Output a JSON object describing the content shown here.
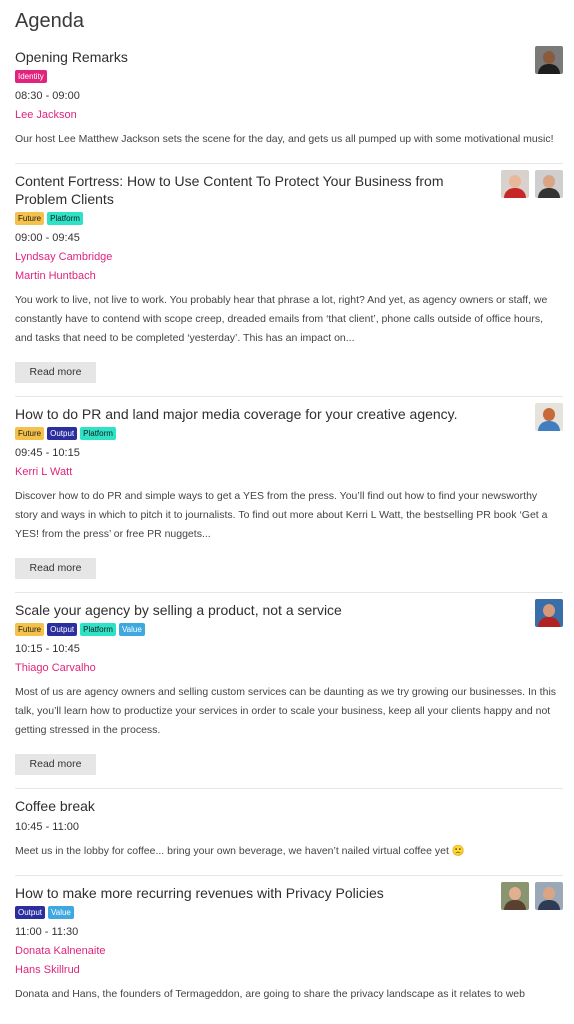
{
  "page": {
    "title": "Agenda"
  },
  "tag_colors": {
    "Identity": {
      "bg": "#e0247e",
      "fg": "#ffffff"
    },
    "Future": {
      "bg": "#f4c24a",
      "fg": "#1a1a1a"
    },
    "Platform": {
      "bg": "#2de2c6",
      "fg": "#1a1a1a"
    },
    "Output": {
      "bg": "#2b2f9e",
      "fg": "#ffffff"
    },
    "Value": {
      "bg": "#3fa8e0",
      "fg": "#ffffff"
    }
  },
  "sessions": [
    {
      "title": "Opening Remarks",
      "tags": [
        "Identity"
      ],
      "time": "08:30 - 09:00",
      "speakers": [
        "Lee Jackson"
      ],
      "description": "Our host Lee Matthew Jackson sets the scene for the day, and gets us all pumped up with some motivational music!",
      "read_more": "",
      "avatars": [
        {
          "bg": "#7a7a7a",
          "skin": "#8a5a3c",
          "shirt": "#1e1e1e"
        }
      ]
    },
    {
      "title": "Content Fortress: How to Use Content To Protect Your Business from Problem Clients",
      "tags": [
        "Future",
        "Platform"
      ],
      "time": "09:00 - 09:45",
      "speakers": [
        "Lyndsay Cambridge",
        "Martin Huntbach"
      ],
      "description": "You work to live, not live to work. You probably hear that phrase a lot, right? And yet, as agency owners or staff, we constantly have to contend with scope creep, dreaded emails from ‘that client’, phone calls outside of office hours, and tasks that need to be completed ‘yesterday’. This has an impact on...",
      "read_more": "Read more",
      "avatars": [
        {
          "bg": "#d9d2cc",
          "skin": "#e8b89a",
          "shirt": "#c62828"
        },
        {
          "bg": "#cfcfcf",
          "skin": "#d9a585",
          "shirt": "#333333"
        }
      ]
    },
    {
      "title": "How to do PR and land major media coverage for your creative agency.",
      "tags": [
        "Future",
        "Output",
        "Platform"
      ],
      "time": "09:45 - 10:15",
      "speakers": [
        "Kerri L Watt"
      ],
      "description": "Discover how to do PR and simple ways to get a YES from the press. You’ll find out how to find your newsworthy story and ways in which to pitch it to journalists. To find out more about Kerri L Watt, the bestselling PR book ‘Get a YES! from the press’ or free PR nuggets...",
      "read_more": "Read more",
      "avatars": [
        {
          "bg": "#e6e2dc",
          "skin": "#c8693a",
          "shirt": "#3f7fbf"
        }
      ]
    },
    {
      "title": "Scale your agency by selling a product, not a service",
      "tags": [
        "Future",
        "Output",
        "Platform",
        "Value"
      ],
      "time": "10:15 - 10:45",
      "speakers": [
        "Thiago Carvalho"
      ],
      "description": "Most of us are agency owners and selling custom services can be daunting as we try growing our businesses. In this talk, you’ll learn how to productize your services in order to scale your business, keep all your clients happy and not getting stressed in the process.",
      "read_more": "Read more",
      "avatars": [
        {
          "bg": "#3a6ea8",
          "skin": "#d69a7a",
          "shirt": "#b22222"
        }
      ]
    },
    {
      "title": "Coffee break",
      "tags": [],
      "time": "10:45 - 11:00",
      "speakers": [],
      "description": "Meet us in the lobby for coffee... bring your own beverage, we haven’t nailed virtual coffee yet 🙁",
      "read_more": "",
      "avatars": []
    },
    {
      "title": "How to make more recurring revenues with Privacy Policies",
      "tags": [
        "Output",
        "Value"
      ],
      "time": "11:00 - 11:30",
      "speakers": [
        "Donata Kalnenaite",
        "Hans Skillrud"
      ],
      "description": "Donata and Hans, the founders of Termageddon, are going to share the privacy landscape as it relates to web",
      "read_more": "",
      "avatars": [
        {
          "bg": "#8a9470",
          "skin": "#e0b090",
          "shirt": "#5a4030"
        },
        {
          "bg": "#9aa8b8",
          "skin": "#d9a585",
          "shirt": "#2d3b55"
        }
      ]
    }
  ]
}
